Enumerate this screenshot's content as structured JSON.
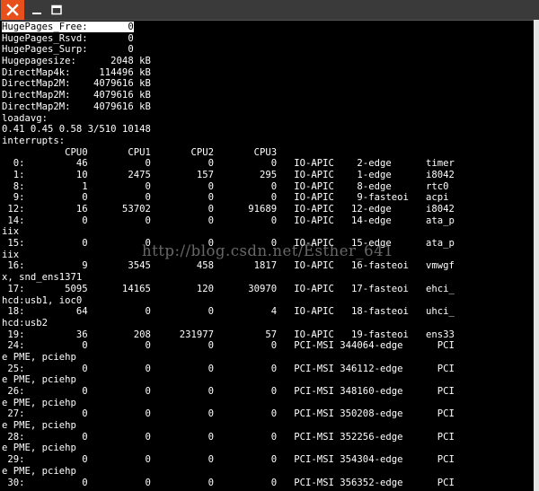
{
  "window": {
    "close_icon": "close-icon",
    "minimize_icon": "minimize-icon",
    "maximize_icon": "maximize-icon",
    "accent": "#e8501b"
  },
  "console": {
    "highlighted": "HugePages_Free:       0",
    "lines": [
      "HugePages_Rsvd:       0",
      "HugePages_Surp:       0",
      "Hugepagesize:      2048 kB",
      "DirectMap4k:     114496 kB",
      "DirectMap2M:    4079616 kB",
      "DirectMap2M:    4079616 kB",
      "DirectMap2M:    4079616 kB",
      "loadavg:",
      "0.41 0.45 0.58 3/510 10148",
      "interrupts:",
      "           CPU0       CPU1       CPU2       CPU3",
      "  0:         46          0          0          0   IO-APIC    2-edge      timer",
      "  1:         10       2475        157        295   IO-APIC    1-edge      i8042",
      "  8:          1          0          0          0   IO-APIC    8-edge      rtc0",
      "  9:          0          0          0          0   IO-APIC    9-fasteoi   acpi",
      " 12:         16      53702          0      91689   IO-APIC   12-edge      i8042",
      " 14:          0          0          0          0   IO-APIC   14-edge      ata_p",
      "iix",
      " 15:          0          0          0          0   IO-APIC   15-edge      ata_p",
      "iix",
      " 16:          9       3545        458       1817   IO-APIC   16-fasteoi   vmwgf",
      "x, snd_ens1371",
      " 17:       5095      14165        120      30970   IO-APIC   17-fasteoi   ehci_",
      "hcd:usb1, ioc0",
      " 18:         64          0          0          4   IO-APIC   18-fasteoi   uhci_",
      "hcd:usb2",
      " 19:         36        208     231977         57   IO-APIC   19-fasteoi   ens33",
      " 24:          0          0          0          0   PCI-MSI 344064-edge      PCI",
      "e PME, pciehp",
      " 25:          0          0          0          0   PCI-MSI 346112-edge      PCI",
      "e PME, pciehp",
      " 26:          0          0          0          0   PCI-MSI 348160-edge      PCI",
      "e PME, pciehp",
      " 27:          0          0          0          0   PCI-MSI 350208-edge      PCI",
      "e PME, pciehp",
      " 28:          0          0          0          0   PCI-MSI 352256-edge      PCI",
      "e PME, pciehp",
      " 29:          0          0          0          0   PCI-MSI 354304-edge      PCI",
      "e PME, pciehp",
      " 30:          0          0          0          0   PCI-MSI 356352-edge      PCI"
    ]
  },
  "watermark": "http://blog.csdn.net/Esther_641"
}
